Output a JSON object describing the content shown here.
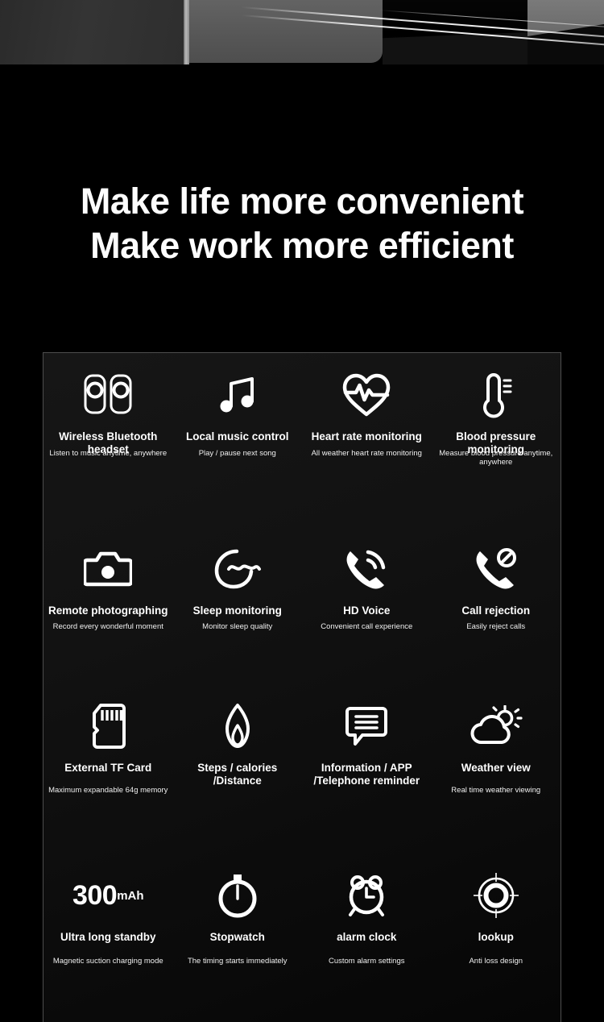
{
  "photo_strip": {
    "description": "cropped-product-photo-strip"
  },
  "headline": {
    "line1": "Make life more convenient",
    "line2": "Make work more efficient"
  },
  "features": {
    "rows": [
      {
        "cells": [
          {
            "icon": "bluetooth-earbuds-icon",
            "title": "Wireless Bluetooth headset",
            "subtitle": "Listen to music anytime, anywhere"
          },
          {
            "icon": "music-note-icon",
            "title": "Local music control",
            "subtitle": "Play / pause next song"
          },
          {
            "icon": "heart-pulse-icon",
            "title": "Heart rate monitoring",
            "subtitle": "All weather heart rate monitoring"
          },
          {
            "icon": "thermometer-icon",
            "title": "Blood pressure monitoring",
            "subtitle": "Measure blood pressure anytime, anywhere"
          }
        ]
      },
      {
        "cells": [
          {
            "icon": "camera-icon",
            "title": "Remote photographing",
            "subtitle": "Record every wonderful moment"
          },
          {
            "icon": "moon-sleep-icon",
            "title": "Sleep monitoring",
            "subtitle": "Monitor sleep quality"
          },
          {
            "icon": "phone-call-icon",
            "title": "HD Voice",
            "subtitle": "Convenient call experience"
          },
          {
            "icon": "phone-reject-icon",
            "title": "Call rejection",
            "subtitle": "Easily reject calls"
          }
        ]
      },
      {
        "cells": [
          {
            "icon": "microsd-card-icon",
            "title": "External TF Card",
            "subtitle": "Maximum expandable 64g memory"
          },
          {
            "icon": "flame-icon",
            "title": "Steps / calories /Distance",
            "subtitle": ""
          },
          {
            "icon": "message-bubble-icon",
            "title": "Information / APP /Telephone reminder",
            "subtitle": ""
          },
          {
            "icon": "cloud-sun-icon",
            "title": "Weather view",
            "subtitle": "Real time weather viewing"
          }
        ]
      },
      {
        "cells": [
          {
            "icon": "battery-capacity-text",
            "capacity_value": "300",
            "capacity_unit": "mAh",
            "title": "Ultra long standby",
            "subtitle": "Magnetic suction charging mode"
          },
          {
            "icon": "stopwatch-icon",
            "title": "Stopwatch",
            "subtitle": "The timing starts immediately"
          },
          {
            "icon": "alarm-clock-icon",
            "title": "alarm clock",
            "subtitle": "Custom alarm settings"
          },
          {
            "icon": "crosshair-target-icon",
            "title": "lookup",
            "subtitle": "Anti loss design"
          }
        ]
      }
    ]
  },
  "colors": {
    "background": "#000000",
    "panel_bg": "#121212",
    "panel_border": "#4e4e4e",
    "text": "#ffffff"
  }
}
